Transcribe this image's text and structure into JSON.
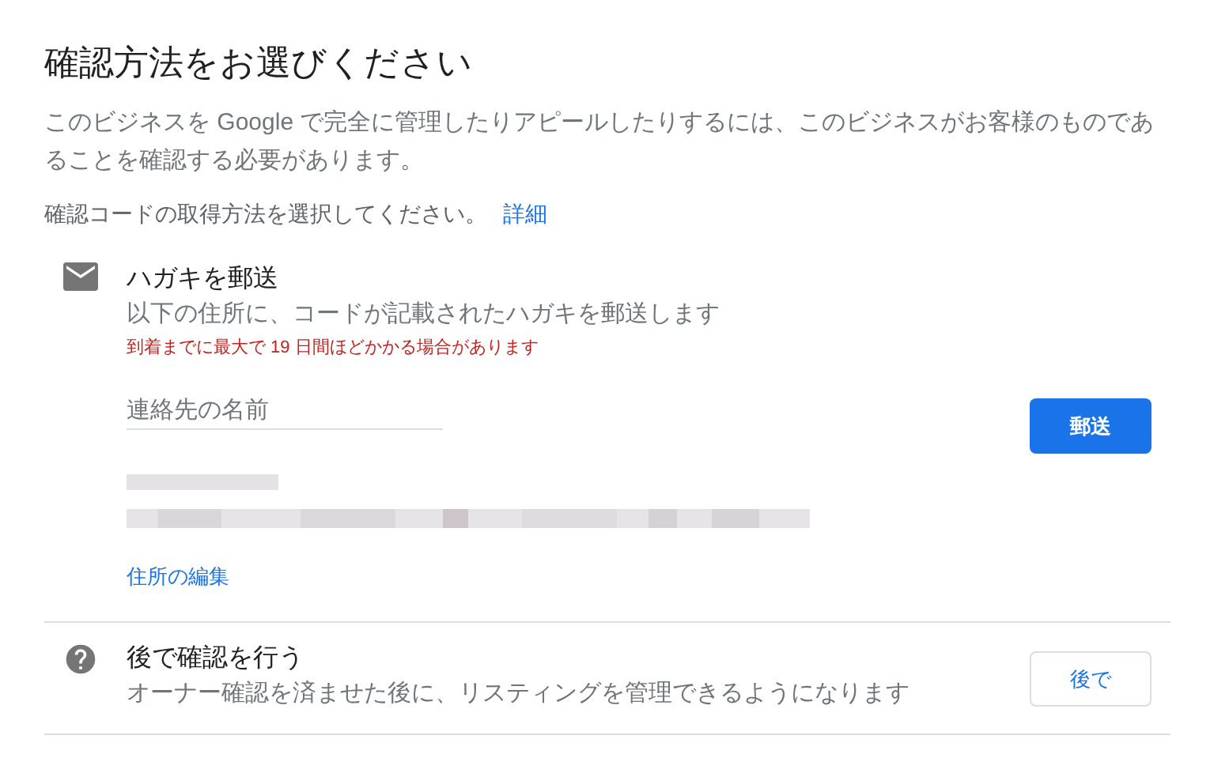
{
  "title": "確認方法をお選びください",
  "intro": "このビジネスを Google で完全に管理したりアピールしたりするには、このビジネスがお客様のものであることを確認する必要があります。",
  "instruction": {
    "text": "確認コードの取得方法を選択してください。",
    "link": "詳細"
  },
  "options": [
    {
      "kind": "postcard",
      "title": "ハガキを郵送",
      "description": "以下の住所に、コードが記載されたハガキを郵送します",
      "note": "到着までに最大で 19 日間ほどかかる場合があります",
      "field": {
        "placeholder": "連絡先の名前"
      },
      "address": {
        "kind": "redacted"
      },
      "link": "住所の編集",
      "button": {
        "label": "郵送",
        "primary": true
      }
    },
    {
      "kind": "later",
      "title": "後で確認を行う",
      "description": "オーナー確認を済ませた後に、リスティングを管理できるようになります",
      "button": {
        "label": "後で",
        "primary": false
      }
    }
  ]
}
